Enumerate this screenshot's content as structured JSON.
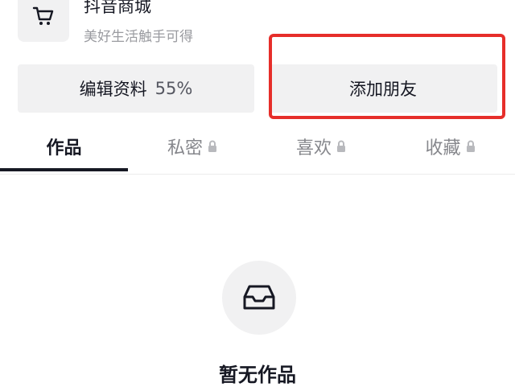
{
  "shop": {
    "icon": "shopping-cart-icon",
    "title": "抖音商城",
    "subtitle": "美好生活触手可得"
  },
  "actions": {
    "edit_profile_label": "编辑资料",
    "edit_profile_completion": "55%",
    "add_friends_label": "添加朋友"
  },
  "tabs": [
    {
      "label": "作品",
      "active": true,
      "locked": false
    },
    {
      "label": "私密",
      "active": false,
      "locked": true
    },
    {
      "label": "喜欢",
      "active": false,
      "locked": true
    },
    {
      "label": "收藏",
      "active": false,
      "locked": true
    }
  ],
  "empty_state": {
    "icon": "inbox-tray-icon",
    "text": "暂无作品"
  },
  "colors": {
    "highlight": "#e62e2a",
    "active_tab": "#161823",
    "inactive_tab": "#86878c",
    "button_bg": "#f1f1f2"
  }
}
